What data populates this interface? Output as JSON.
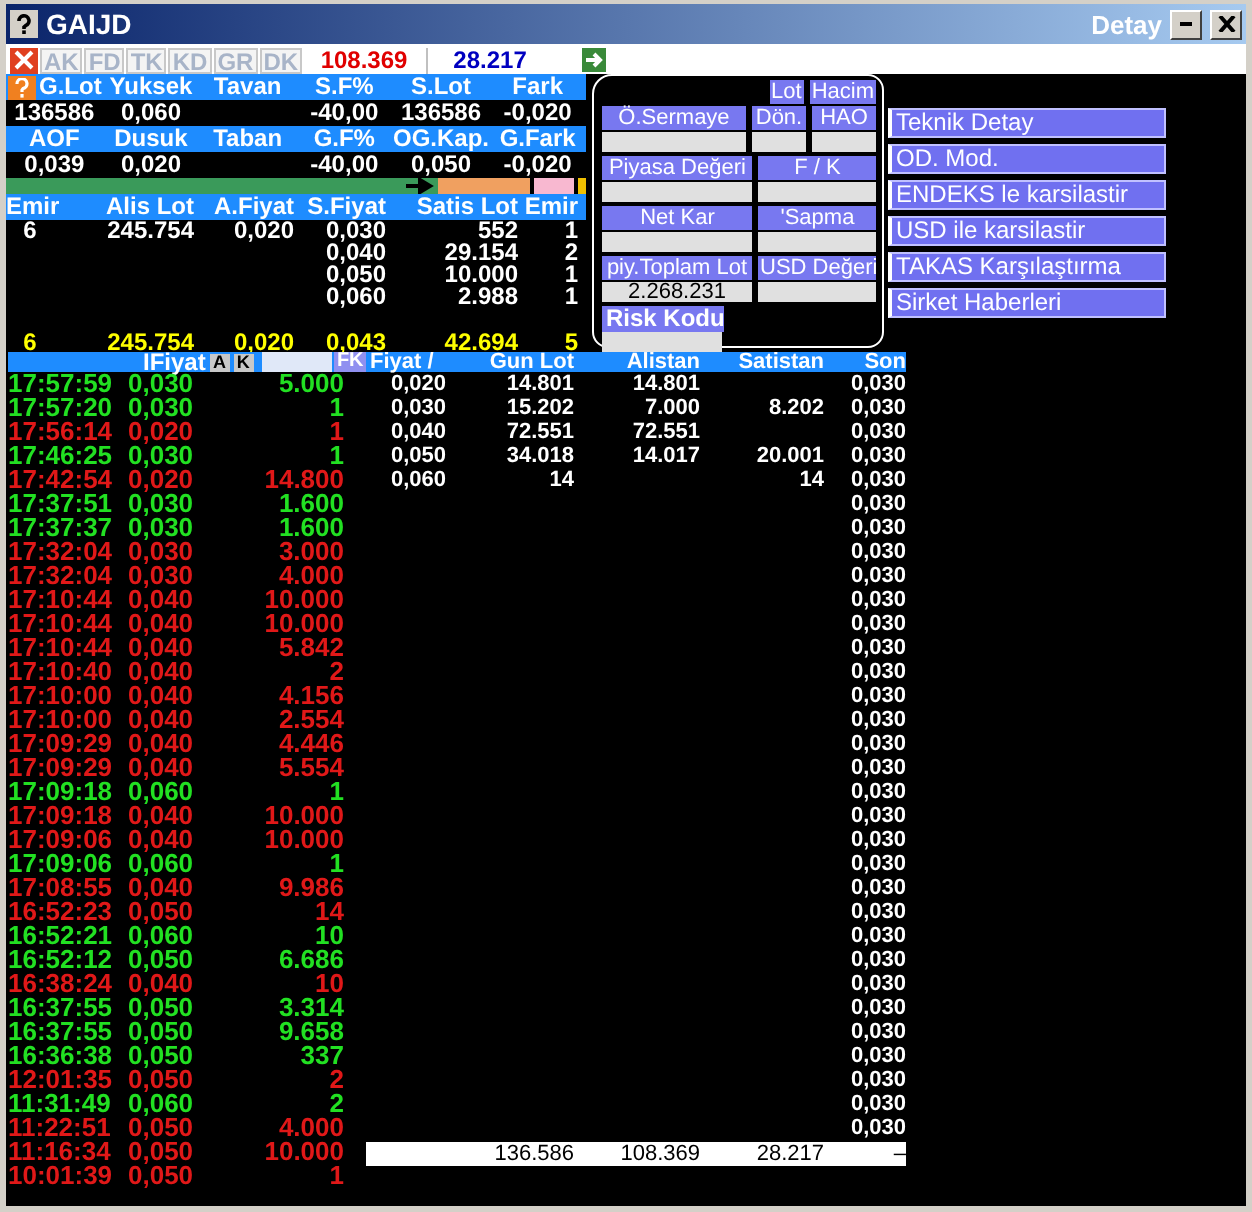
{
  "window": {
    "title": "GAIJD",
    "caption": "Detay"
  },
  "toolbar": {
    "tabs": [
      {
        "label": "AK",
        "disabled": true
      },
      {
        "label": "FD",
        "disabled": true
      },
      {
        "label": "TK",
        "disabled": true
      },
      {
        "label": "KD",
        "disabled": true
      },
      {
        "label": "GR",
        "disabled": true
      },
      {
        "label": "DK",
        "disabled": true
      }
    ],
    "buy_total": "108.369",
    "sell_total": "28.217"
  },
  "summary": {
    "rows": [
      {
        "kind": "header",
        "cells": [
          "G.Lot",
          "Yuksek",
          "Tavan",
          "S.F%",
          "S.Lot",
          "Fark"
        ]
      },
      {
        "kind": "value",
        "cells": [
          "136586",
          "0,060",
          "",
          "-40,00",
          "136586",
          "-0,020"
        ]
      },
      {
        "kind": "header",
        "cells": [
          "AOF",
          "Dusuk",
          "Taban",
          "G.F%",
          "OG.Kap.",
          "G.Fark"
        ]
      },
      {
        "kind": "value",
        "cells": [
          "0,039",
          "0,020",
          "",
          "-40,00",
          "0,050",
          "-0,020"
        ]
      }
    ]
  },
  "order_book": {
    "columns": [
      "Emir",
      "Alis Lot",
      "A.Fiyat",
      "S.Fiyat",
      "Satis Lot",
      "Emir"
    ],
    "rows": [
      [
        "6",
        "245.754",
        "0,020",
        "0,030",
        "552",
        "1"
      ],
      [
        "",
        "",
        "",
        "0,040",
        "29.154",
        "2"
      ],
      [
        "",
        "",
        "",
        "0,050",
        "10.000",
        "1"
      ],
      [
        "",
        "",
        "",
        "0,060",
        "2.988",
        "1"
      ]
    ],
    "totals": [
      "6",
      "245.754",
      "0,020",
      "0,043",
      "42.694",
      "5"
    ]
  },
  "detail_panel": {
    "toggles": [
      "Lot",
      "Hacim"
    ],
    "rows": [
      [
        {
          "label": "Ö.Sermaye"
        },
        {
          "label": "Dön."
        },
        {
          "label": "HAO"
        }
      ],
      [
        {
          "label": "Piyasa Değeri"
        },
        {
          "label": "F / K"
        }
      ],
      [
        {
          "label": "Net Kar"
        },
        {
          "label": "'Sapma"
        }
      ],
      [
        {
          "label": "piy.Toplam Lot",
          "value": "2.268.231"
        },
        {
          "label": "USD Değeri"
        }
      ]
    ],
    "risk_label": "Risk Kodu"
  },
  "links": [
    "Teknik Detay",
    "OD. Mod.",
    "ENDEKS le karsilastir",
    "USD ile karsilastir",
    "TAKAS Karşılaştırma",
    "Sirket Haberleri"
  ],
  "trades": {
    "header": "IFiyat",
    "buttons": [
      "A",
      "K"
    ],
    "filter_button": "FK",
    "rows": [
      {
        "time": "17:57:59",
        "price": "0,030",
        "lot": "5.000",
        "color": "#22e022"
      },
      {
        "time": "17:57:20",
        "price": "0,030",
        "lot": "1",
        "color": "#22e022"
      },
      {
        "time": "17:56:14",
        "price": "0,020",
        "lot": "1",
        "color": "#e01818"
      },
      {
        "time": "17:46:25",
        "price": "0,030",
        "lot": "1",
        "color": "#22e022"
      },
      {
        "time": "17:42:54",
        "price": "0,020",
        "lot": "14.800",
        "color": "#e01818"
      },
      {
        "time": "17:37:51",
        "price": "0,030",
        "lot": "1.600",
        "color": "#22e022"
      },
      {
        "time": "17:37:37",
        "price": "0,030",
        "lot": "1.600",
        "color": "#22e022"
      },
      {
        "time": "17:32:04",
        "price": "0,030",
        "lot": "3.000",
        "color": "#e01818"
      },
      {
        "time": "17:32:04",
        "price": "0,030",
        "lot": "4.000",
        "color": "#e01818"
      },
      {
        "time": "17:10:44",
        "price": "0,040",
        "lot": "10.000",
        "color": "#e01818"
      },
      {
        "time": "17:10:44",
        "price": "0,040",
        "lot": "10.000",
        "color": "#e01818"
      },
      {
        "time": "17:10:44",
        "price": "0,040",
        "lot": "5.842",
        "color": "#e01818"
      },
      {
        "time": "17:10:40",
        "price": "0,040",
        "lot": "2",
        "color": "#e01818"
      },
      {
        "time": "17:10:00",
        "price": "0,040",
        "lot": "4.156",
        "color": "#e01818"
      },
      {
        "time": "17:10:00",
        "price": "0,040",
        "lot": "2.554",
        "color": "#e01818"
      },
      {
        "time": "17:09:29",
        "price": "0,040",
        "lot": "4.446",
        "color": "#e01818"
      },
      {
        "time": "17:09:29",
        "price": "0,040",
        "lot": "5.554",
        "color": "#e01818"
      },
      {
        "time": "17:09:18",
        "price": "0,060",
        "lot": "1",
        "color": "#22e022"
      },
      {
        "time": "17:09:18",
        "price": "0,040",
        "lot": "10.000",
        "color": "#e01818"
      },
      {
        "time": "17:09:06",
        "price": "0,040",
        "lot": "10.000",
        "color": "#e01818"
      },
      {
        "time": "17:09:06",
        "price": "0,060",
        "lot": "1",
        "color": "#22e022"
      },
      {
        "time": "17:08:55",
        "price": "0,040",
        "lot": "9.986",
        "color": "#e01818"
      },
      {
        "time": "16:52:23",
        "price": "0,050",
        "lot": "14",
        "color": "#e01818"
      },
      {
        "time": "16:52:21",
        "price": "0,060",
        "lot": "10",
        "color": "#22e022"
      },
      {
        "time": "16:52:12",
        "price": "0,050",
        "lot": "6.686",
        "color": "#22e022"
      },
      {
        "time": "16:38:24",
        "price": "0,040",
        "lot": "10",
        "color": "#e01818"
      },
      {
        "time": "16:37:55",
        "price": "0,050",
        "lot": "3.314",
        "color": "#22e022"
      },
      {
        "time": "16:37:55",
        "price": "0,050",
        "lot": "9.658",
        "color": "#22e022"
      },
      {
        "time": "16:36:38",
        "price": "0,050",
        "lot": "337",
        "color": "#22e022"
      },
      {
        "time": "12:01:35",
        "price": "0,050",
        "lot": "2",
        "color": "#e01818"
      },
      {
        "time": "11:31:49",
        "price": "0,060",
        "lot": "2",
        "color": "#22e022"
      },
      {
        "time": "11:22:51",
        "price": "0,050",
        "lot": "4.000",
        "color": "#e01818"
      },
      {
        "time": "11:16:34",
        "price": "0,050",
        "lot": "10.000",
        "color": "#e01818"
      },
      {
        "time": "10:01:39",
        "price": "0,050",
        "lot": "1",
        "color": "#e01818"
      }
    ]
  },
  "price_table": {
    "columns": [
      "Fiyat /",
      "Gun Lot",
      "Alistan",
      "Satistan",
      "Son"
    ],
    "rows": [
      {
        "fiyat": "0,020",
        "gun_lot": "14.801",
        "alistan": "14.801",
        "son": "0,030"
      },
      {
        "fiyat": "0,030",
        "gun_lot": "15.202",
        "alistan": "7.000",
        "satistan": "8.202",
        "son": "0,030"
      },
      {
        "fiyat": "0,040",
        "gun_lot": "72.551",
        "alistan": "72.551",
        "son": "0,030"
      },
      {
        "fiyat": "0,050",
        "gun_lot": "34.018",
        "alistan": "14.017",
        "satistan": "20.001",
        "son": "0,030"
      },
      {
        "fiyat": "0,060",
        "gun_lot": "14",
        "satistan": "14",
        "son": "0,030"
      },
      {
        "son": "0,030"
      },
      {
        "son": "0,030"
      },
      {
        "son": "0,030"
      },
      {
        "son": "0,030"
      },
      {
        "son": "0,030"
      },
      {
        "son": "0,030"
      },
      {
        "son": "0,030"
      },
      {
        "son": "0,030"
      },
      {
        "son": "0,030"
      },
      {
        "son": "0,030"
      },
      {
        "son": "0,030"
      },
      {
        "son": "0,030"
      },
      {
        "son": "0,030"
      },
      {
        "son": "0,030"
      },
      {
        "son": "0,030"
      },
      {
        "son": "0,030"
      },
      {
        "son": "0,030"
      },
      {
        "son": "0,030"
      },
      {
        "son": "0,030"
      },
      {
        "son": "0,030"
      },
      {
        "son": "0,030"
      },
      {
        "son": "0,030"
      },
      {
        "son": "0,030"
      },
      {
        "son": "0,030"
      },
      {
        "son": "0,030"
      },
      {
        "son": "0,030"
      },
      {
        "son": "0,030"
      }
    ],
    "totals": {
      "gun_lot": "136.586",
      "alistan": "108.369",
      "satistan": "28.217",
      "son": "–"
    }
  }
}
